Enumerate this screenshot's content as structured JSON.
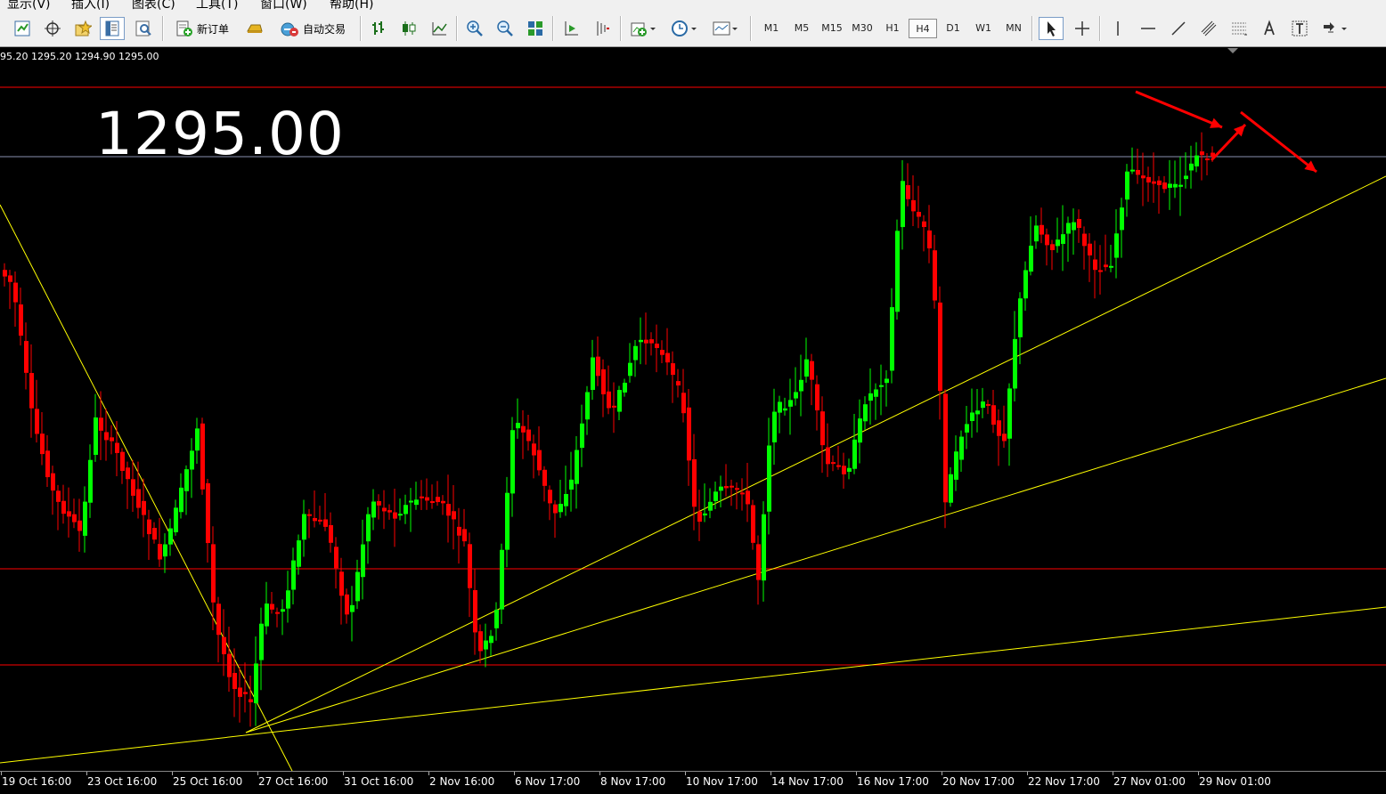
{
  "menu": {
    "items": [
      "显示(V)",
      "插入(I)",
      "图表(C)",
      "工具(T)",
      "窗口(W)",
      "帮助(H)"
    ]
  },
  "toolbar": {
    "new_order_label": "新订单",
    "auto_trade_label": "自动交易",
    "timeframes": [
      "M1",
      "M5",
      "M15",
      "M30",
      "H1",
      "H4",
      "D1",
      "W1",
      "MN"
    ],
    "active_timeframe": "H4",
    "icons": [
      "new-chart-icon",
      "crosshair-move-icon",
      "favorites-icon",
      "data-window-icon",
      "strategy-tester-icon",
      "new-order-icon",
      "gold-bar-icon",
      "auto-trade-icon",
      "bar-chart-icon",
      "candlestick-icon",
      "line-chart-icon",
      "zoom-in-icon",
      "zoom-out-icon",
      "tile-windows-icon",
      "auto-scroll-icon",
      "chart-shift-icon",
      "indicators-icon",
      "periods-icon",
      "templates-icon",
      "cursor-icon",
      "crosshair-icon",
      "vertical-line-icon",
      "horizontal-line-icon",
      "trendline-icon",
      "equidistant-channel-icon",
      "fibonacci-icon",
      "text-icon",
      "text-label-icon",
      "arrows-icon"
    ]
  },
  "chart": {
    "ohlc_readout": "95.20 1295.20 1294.90 1295.00",
    "big_price": "1295.00",
    "bull_color": "#00ff00",
    "bear_color": "#ff0000",
    "trend_color": "#ffff00",
    "level_color": "#ff0000",
    "x_labels": [
      "19 Oct 16:00",
      "23 Oct 16:00",
      "25 Oct 16:00",
      "27 Oct 16:00",
      "31 Oct 16:00",
      "2 Nov 16:00",
      "6 Nov 17:00",
      "8 Nov 17:00",
      "10 Nov 17:00",
      "14 Nov 17:00",
      "16 Nov 17:00",
      "20 Nov 17:00",
      "22 Nov 17:00",
      "27 Nov 01:00",
      "29 Nov 01:00"
    ]
  }
}
